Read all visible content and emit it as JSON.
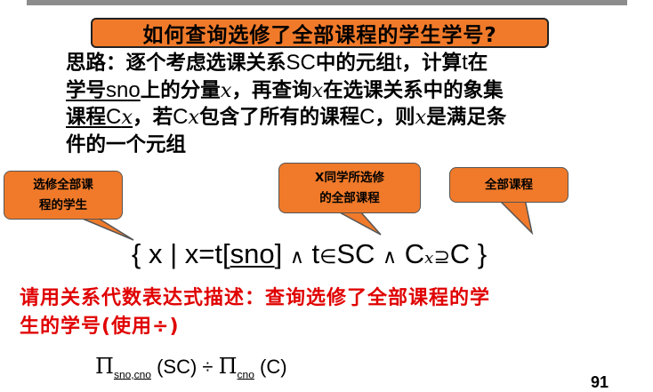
{
  "title": "如何查询选修了全部课程的学生学号?",
  "paragraph": {
    "l1_a": "思路：逐个考虑选课关系",
    "l1_sc": "SC",
    "l1_b": "中的元组",
    "l1_t": "t",
    "l1_c": "，计算",
    "l1_t2": "t",
    "l1_d": "在",
    "l2_a": "学号",
    "l2_sno": "sno",
    "l2_b": "上的分量",
    "l2_x": "x",
    "l2_c": "，再查询",
    "l2_x2": "x",
    "l2_d": "在选课关系中的象集",
    "l3_a": "课程",
    "l3_C": "C",
    "l3_x": "x",
    "l3_b": "，若",
    "l3_C2": "C",
    "l3_x2": "x",
    "l3_c": "包含了所有的课程",
    "l3_C3": "C",
    "l3_d": "，则",
    "l3_x3": "x",
    "l3_e": "是满足条",
    "l4": "件的一个元组"
  },
  "callouts": {
    "left_l1": "选修全部课",
    "left_l2": "程的学生",
    "mid_l1": "X同学所选修",
    "mid_l2": "的全部课程",
    "right": "全部课程"
  },
  "formula": {
    "open": "{ x | x=t[",
    "sno": "sno",
    "close1": "]",
    "and1": "∧",
    "t": "t",
    "in": "∈",
    "SC": "SC",
    "and2": "∧",
    "Cx": "C",
    "x": "x",
    "sup": "⊇",
    "C": "C",
    "close2": "}"
  },
  "question": {
    "l1": "请用关系代数表达式描述：查询选修了全部课程的学",
    "l2": "生的学号(使用÷)"
  },
  "expression": {
    "pi1": "Π",
    "sub1": "sno,cno",
    "part1": " (SC) ÷ ",
    "pi2": "Π",
    "sub2": "cno",
    "part2": " (C)"
  },
  "page_number": "91",
  "colors": {
    "orange": "#f07a2a",
    "red": "#e00000",
    "bar": "#8c8c8c"
  }
}
